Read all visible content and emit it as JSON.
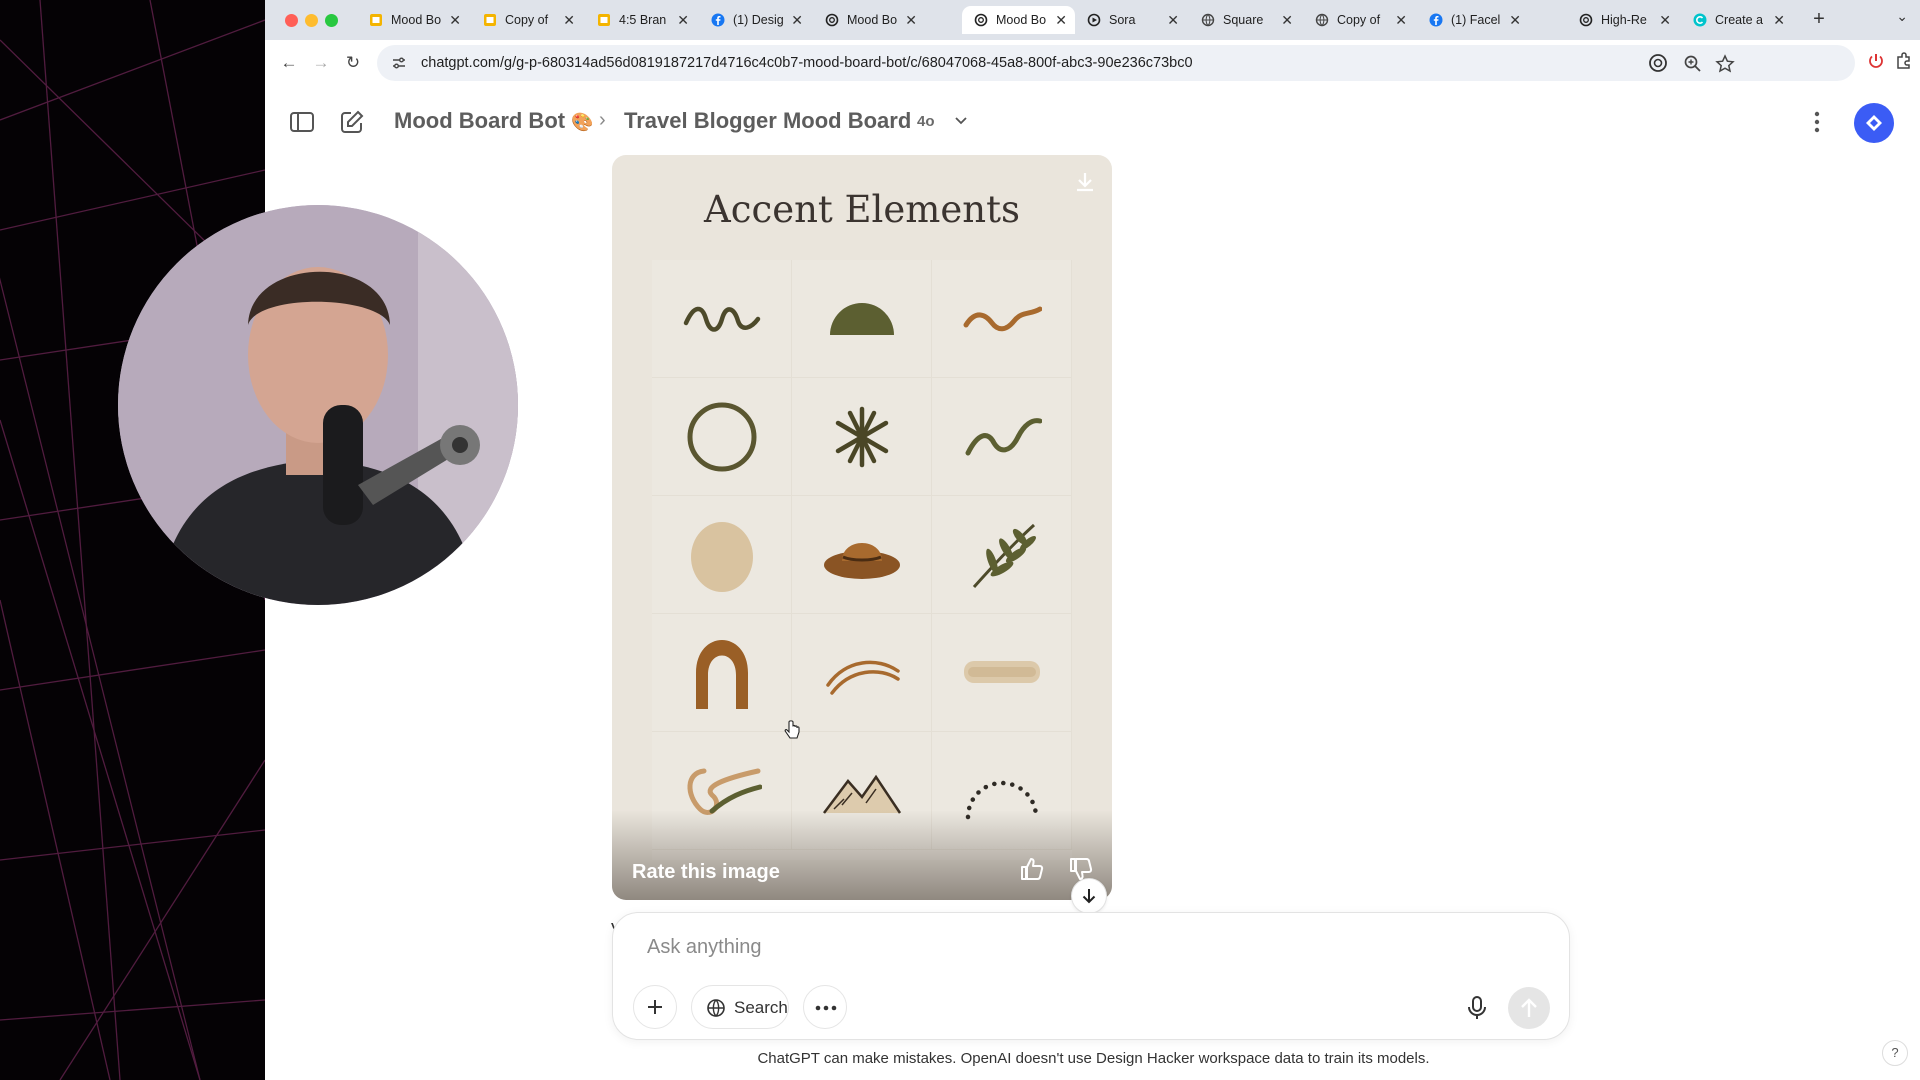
{
  "browser": {
    "tabs": [
      {
        "label": "Mood Bo",
        "icon": "slides-icon",
        "active": false
      },
      {
        "label": "Copy of",
        "icon": "slides-icon",
        "active": false
      },
      {
        "label": "4:5 Bran",
        "icon": "slides-icon",
        "active": false
      },
      {
        "label": "(1) Desig",
        "icon": "facebook-icon",
        "active": false
      },
      {
        "label": "Mood Bo",
        "icon": "openai-icon",
        "active": false
      },
      {
        "label": "Mood Bo",
        "icon": "openai-icon",
        "active": true
      },
      {
        "label": "Sora",
        "icon": "sora-icon",
        "active": false
      },
      {
        "label": "Square",
        "icon": "globe-icon",
        "active": false
      },
      {
        "label": "Copy of",
        "icon": "globe-icon",
        "active": false
      },
      {
        "label": "(1) Facel",
        "icon": "facebook-icon",
        "active": false
      },
      {
        "label": "High-Re",
        "icon": "openai-icon",
        "active": false
      },
      {
        "label": "Create a",
        "icon": "canva-icon",
        "active": false
      }
    ],
    "url": "chatgpt.com/g/g-p-680314ad56d0819187217d4716c4c0b7-mood-board-bot/c/68047068-45a8-800f-abc3-90e236c73bc0"
  },
  "header": {
    "gpt_name": "Mood Board Bot",
    "gpt_emoji": "🎨",
    "chat_title": "Travel Blogger Mood Board",
    "model": "4o"
  },
  "image": {
    "title": "Accent Elements",
    "rate_label": "Rate this image",
    "icons": [
      "squiggle-icon",
      "half-circle-icon",
      "brush-squiggle-icon",
      "ring-icon",
      "asterisk-icon",
      "wave-stroke-icon",
      "pebble-icon",
      "hat-icon",
      "leaf-sprig-icon",
      "arch-icon",
      "double-arc-icon",
      "brush-smear-icon",
      "curly-stroke-icon",
      "mountain-sketch-icon",
      "dotted-arc-icon"
    ]
  },
  "composer": {
    "placeholder": "Ask anything",
    "search_label": "Search"
  },
  "peek_text": "V",
  "footer": {
    "disclaimer": "ChatGPT can make mistakes. OpenAI doesn't use Design Hacker workspace data to train its models.",
    "help": "?"
  },
  "colors": {
    "accent": "#3b5cf5",
    "olive": "#5c5f31",
    "terracotta": "#a86a2e",
    "sand": "#d9c3a0"
  }
}
